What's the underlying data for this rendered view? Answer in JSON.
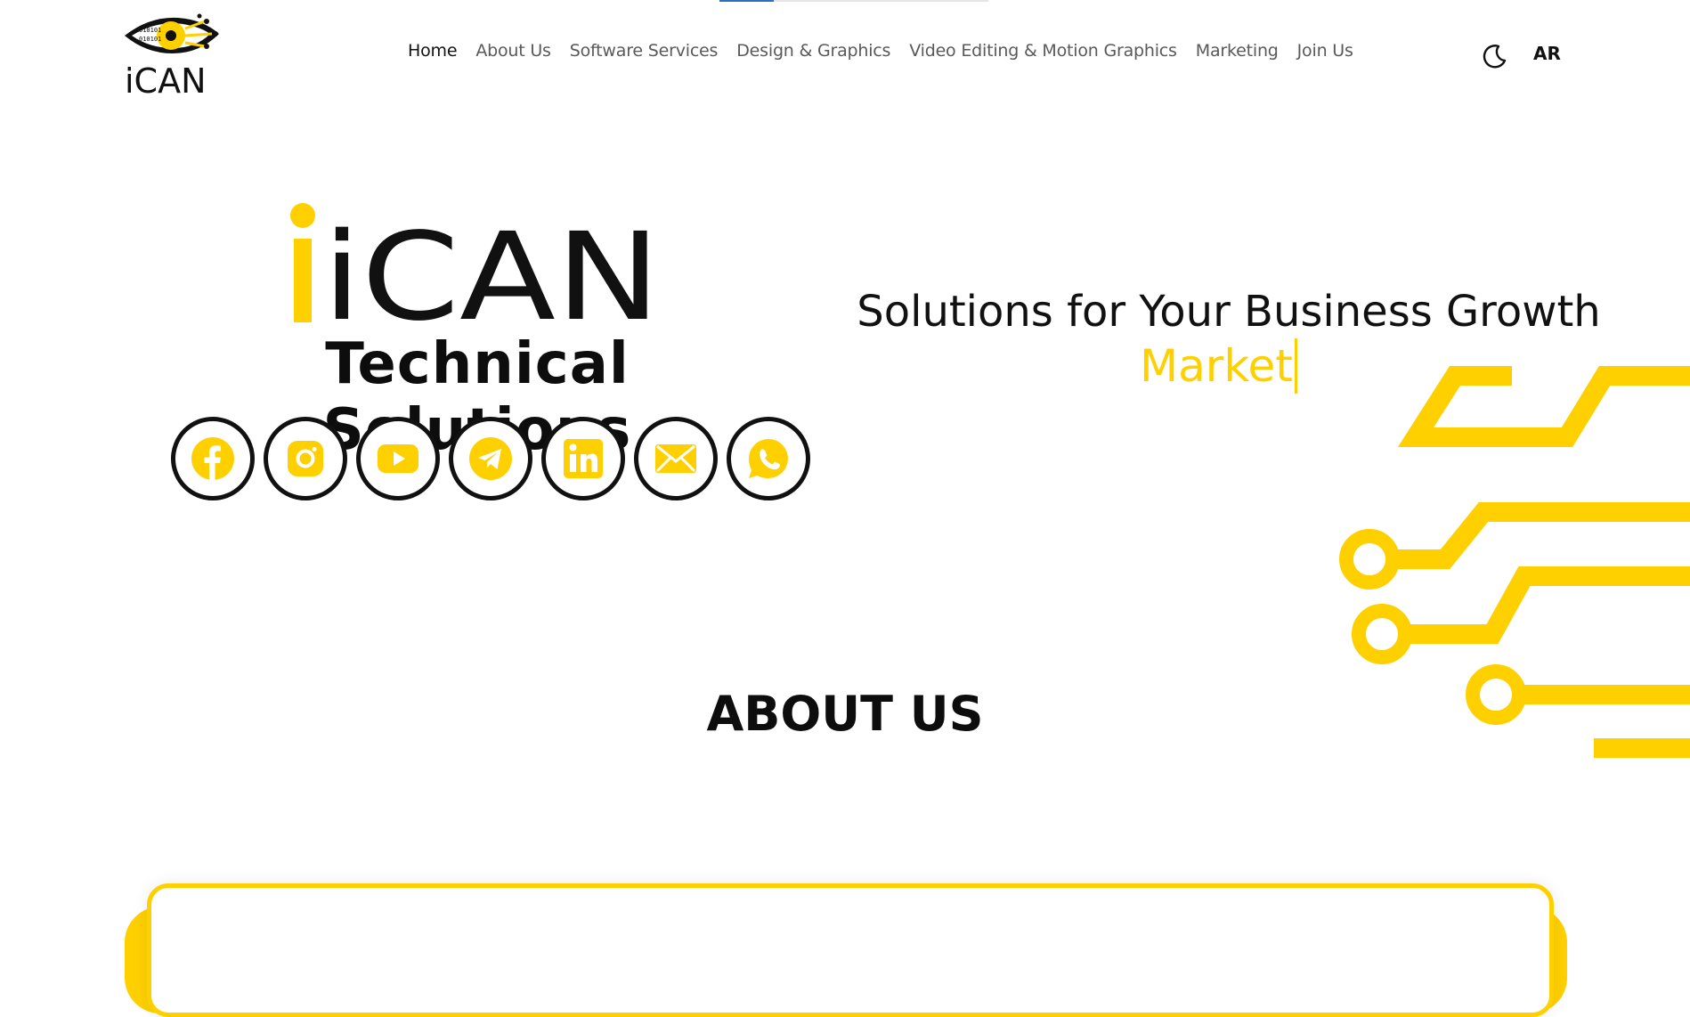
{
  "nav": {
    "items": [
      {
        "label": "Home"
      },
      {
        "label": "About Us"
      },
      {
        "label": "Software Services"
      },
      {
        "label": "Design & Graphics"
      },
      {
        "label": "Video Editing & Motion Graphics"
      },
      {
        "label": "Marketing"
      },
      {
        "label": "Join Us"
      }
    ],
    "lang_label": "AR",
    "theme_icon": "moon-icon"
  },
  "brand": {
    "logo_text": "iCAN",
    "logo_code": "010101"
  },
  "hero": {
    "logo_text": "iCAN",
    "title": "Technical Solutions",
    "tagline": "Solutions for Your Business Growth",
    "typed_word": "Market",
    "socials": [
      {
        "icon": "facebook-icon"
      },
      {
        "icon": "instagram-icon"
      },
      {
        "icon": "youtube-icon"
      },
      {
        "icon": "telegram-icon"
      },
      {
        "icon": "linkedin-icon"
      },
      {
        "icon": "email-icon"
      },
      {
        "icon": "whatsapp-icon"
      }
    ]
  },
  "about": {
    "heading": "ABOUT US"
  },
  "colors": {
    "accent": "#ffd000",
    "text": "#111111",
    "nav_text": "#595959",
    "tab_indicator": "#2f6fc0"
  }
}
